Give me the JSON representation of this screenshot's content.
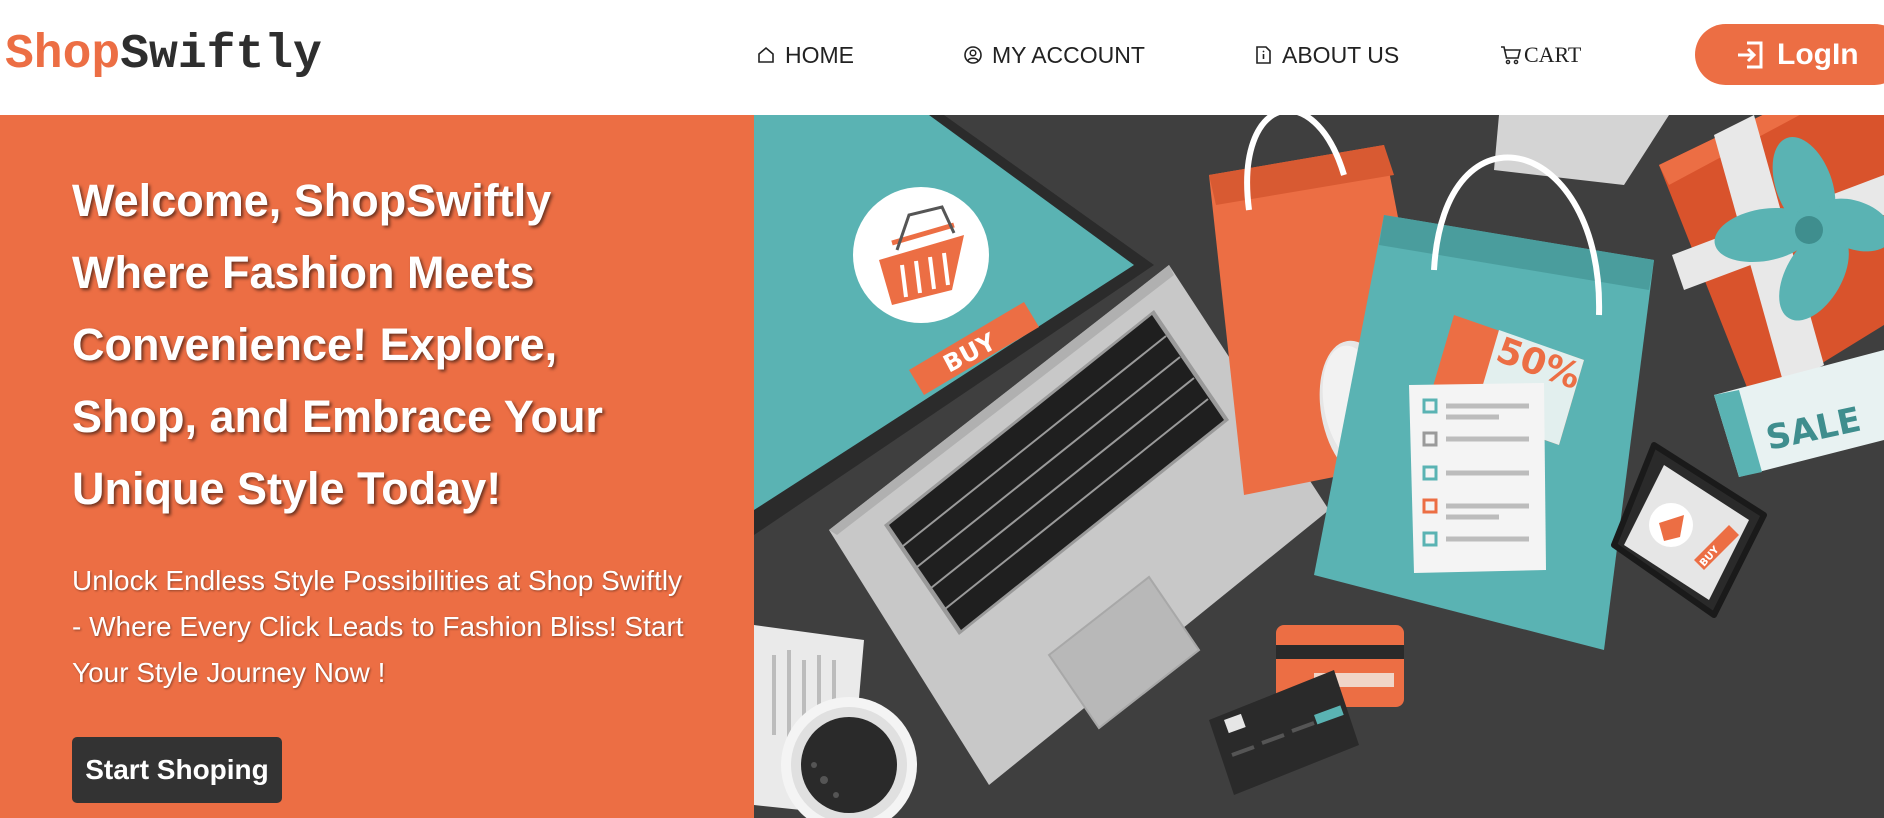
{
  "brand": {
    "part1": "Shop",
    "part2": "Swiftly"
  },
  "nav": {
    "home": "HOME",
    "account": "MY ACCOUNT",
    "about": "ABOUT US",
    "cart": "CART"
  },
  "login_label": "LogIn",
  "hero": {
    "title": "Welcome, ShopSwiftly Where Fashion Meets Convenience! Explore, Shop, and Embrace Your Unique Style Today!",
    "subtitle": "Unlock Endless Style Possibilities at Shop Swiftly - Where Every Click Leads to Fashion Bliss! Start Your Style Journey Now !",
    "cta": "Start Shoping"
  },
  "illustration": {
    "buy_label": "BUY",
    "discount_label": "50%",
    "sale_label": "SALE",
    "phone_buy_label": "BUY"
  },
  "colors": {
    "accent": "#ec6e44",
    "dark": "#333333",
    "teal": "#5ab3b3",
    "desk": "#3f3f3f"
  }
}
